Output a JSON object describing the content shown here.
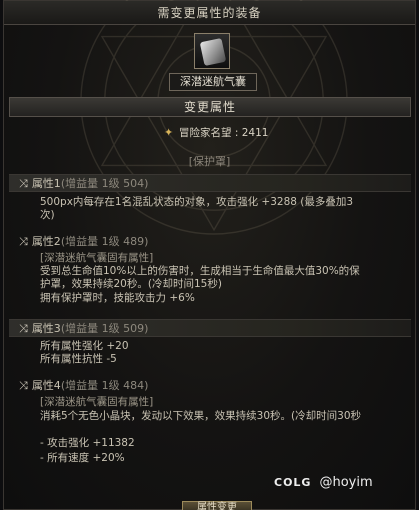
{
  "window": {
    "title": "需变更属性的装备"
  },
  "item": {
    "name": "深潜迷航气囊"
  },
  "section": {
    "label": "变更属性"
  },
  "fame": {
    "label": "冒险家名望 : 2411"
  },
  "protect": {
    "title": "[保护罩]"
  },
  "attributes": [
    {
      "name": "属性1",
      "gain": "(增益量 1级 504)",
      "lines": [
        "500px内每存在1名混乱状态的对象，攻击强化 +3288 (最多叠加3",
        "次)"
      ]
    },
    {
      "name": "属性2",
      "gain": "(增益量 1级 489)",
      "lines": [
        "[深潜迷航气囊固有属性]",
        "受到总生命值10%以上的伤害时，生成相当于生命值最大值30%的保",
        "护罩，效果持续20秒。(冷却时间15秒)",
        "拥有保护罩时，技能攻击力 +6%"
      ]
    },
    {
      "name": "属性3",
      "gain": "(增益量 1级 509)",
      "lines": [
        "所有属性强化 +20",
        "所有属性抗性 -5"
      ]
    },
    {
      "name": "属性4",
      "gain": "(增益量 1级 484)",
      "lines": [
        "[深潜迷航气囊固有属性]",
        "消耗5个无色小晶块，发动以下效果，效果持续30秒。(冷却时间30秒",
        "- 攻击强化 +11382",
        "- 所有速度 +20%"
      ]
    }
  ],
  "icons": {
    "switch": "shuffle-icon",
    "fame": "fame-star-icon",
    "item": "air-bag-item-icon"
  },
  "watermark": {
    "brand": "COLG",
    "handle": "@hoyim"
  },
  "footer": {
    "button_label": "属性变更"
  },
  "colors": {
    "background": "#141312",
    "text": "#c9c3b3",
    "accent": "#d8b45a"
  }
}
